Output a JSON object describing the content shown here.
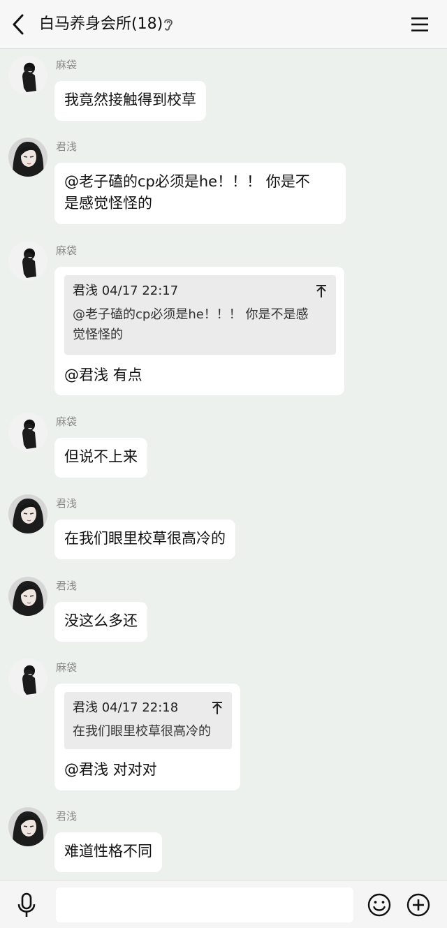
{
  "header": {
    "title": "白马养身会所(18)",
    "back_icon": "chevron-left-icon",
    "ear_icon": "ear-icon",
    "menu_icon": "hamburger-menu-icon"
  },
  "messages": [
    {
      "sender": "麻袋",
      "avatar": "avatar-madai",
      "text": "我竟然接触得到校草"
    },
    {
      "sender": "君浅",
      "avatar": "avatar-junqian",
      "text_lines": [
        "@老子磕的cp必须是he！！！ 你是不",
        "是感觉怪怪的"
      ]
    },
    {
      "sender": "麻袋",
      "avatar": "avatar-madai",
      "quote": {
        "author_time": "君浅 04/17 22:17",
        "body_lines": [
          "@老子磕的cp必须是he！！！ 你是不是感",
          "觉怪怪的"
        ]
      },
      "text": "@君浅 有点"
    },
    {
      "sender": "麻袋",
      "avatar": "avatar-madai",
      "text": "但说不上来"
    },
    {
      "sender": "君浅",
      "avatar": "avatar-junqian",
      "text": "在我们眼里校草很高冷的"
    },
    {
      "sender": "君浅",
      "avatar": "avatar-junqian",
      "text": "没这么多还"
    },
    {
      "sender": "麻袋",
      "avatar": "avatar-madai",
      "quote": {
        "author_time": "君浅 04/17 22:18",
        "body": "在我们眼里校草很高冷的"
      },
      "text": "@君浅 对对对"
    },
    {
      "sender": "君浅",
      "avatar": "avatar-junqian",
      "text": "难道性格不同"
    }
  ],
  "input_bar": {
    "mic_icon": "microphone-icon",
    "input_value": "",
    "emoji_icon": "smiley-icon",
    "plus_icon": "plus-circle-icon"
  },
  "colors": {
    "chat_background": "#edf1ed",
    "bubble": "#ffffff",
    "quote_background": "#ebebeb",
    "sender_name": "#8a8a8a"
  }
}
